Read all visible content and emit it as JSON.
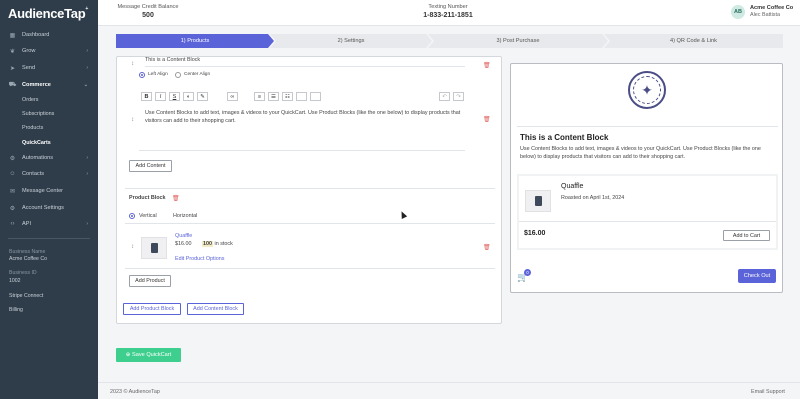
{
  "sidebar": {
    "logo": "AudienceTap",
    "items": [
      {
        "label": "Dashboard",
        "icon": "grid-icon"
      },
      {
        "label": "Grow",
        "icon": "plant-icon",
        "chevron": "›"
      },
      {
        "label": "Send",
        "icon": "send-icon",
        "chevron": "›"
      },
      {
        "label": "Commerce",
        "icon": "cart-icon",
        "chevron": "⌄"
      },
      {
        "label": "Automations",
        "icon": "cog-icon",
        "chevron": "›"
      },
      {
        "label": "Contacts",
        "icon": "user-icon",
        "chevron": "›"
      },
      {
        "label": "Message Center",
        "icon": "chat-icon"
      },
      {
        "label": "Account Settings",
        "icon": "gear-icon"
      },
      {
        "label": "API",
        "icon": "code-icon",
        "chevron": "›"
      }
    ],
    "commerce_sub": [
      "Orders",
      "Subscriptions",
      "Products",
      "QuickCarts"
    ],
    "business_name_label": "Business Name",
    "business_name": "Acme Coffee Co",
    "business_id_label": "Business ID",
    "business_id": "1002",
    "stripe_connect": "Stripe Connect",
    "billing": "Billing"
  },
  "header": {
    "credit_label": "Message Credit Balance",
    "credit_value": "500",
    "texting_label": "Texting Number",
    "texting_value": "1-833-211-1851",
    "avatar_initials": "AB",
    "account_name": "Acme Coffee Co",
    "user_name": "Alec Battista"
  },
  "steps": [
    "1) Products",
    "2) Settings",
    "3) Post Purchase",
    "4) QR Code & Link"
  ],
  "editor": {
    "content_block_title": "This is a Content Block",
    "left_align": "Left Align",
    "center_align": "Center Align",
    "toolbar": {
      "bold": "B",
      "italic": "I",
      "underline": "S"
    },
    "content_text": "Use Content Blocks to add text, images & videos to your QuickCart. Use Product Blocks (like the one below) to display products that visitors can add to their shopping cart.",
    "add_content": "Add Content",
    "product_block_label": "Product Block",
    "vertical": "Vertical",
    "horizontal": "Horizontal",
    "product_name": "Quaffle",
    "product_price": "$16.00",
    "stock_count": "100",
    "stock_label": "in stock",
    "edit_product": "Edit Product Options",
    "add_product": "Add Product",
    "add_product_block": "Add Product Block",
    "add_content_block": "Add Content Block"
  },
  "preview": {
    "title": "This is a Content Block",
    "description": "Use Content Blocks to add text, images & videos to your QuickCart. Use Product Blocks (like the one below) to display products that visitors can add to their shopping cart.",
    "product_name": "Quaffle",
    "product_sub": "Roasted on April 1st, 2024",
    "price": "$16.00",
    "add_to_cart": "Add to Cart",
    "cart_count": "0",
    "checkout": "Check Out"
  },
  "save_button": "Save QuickCart",
  "footer": {
    "copyright": "2023 © AudienceTap",
    "support": "Email Support"
  },
  "colors": {
    "accent": "#5b63d8",
    "save": "#3ecf8e",
    "sidebar": "#2f3d4a"
  }
}
